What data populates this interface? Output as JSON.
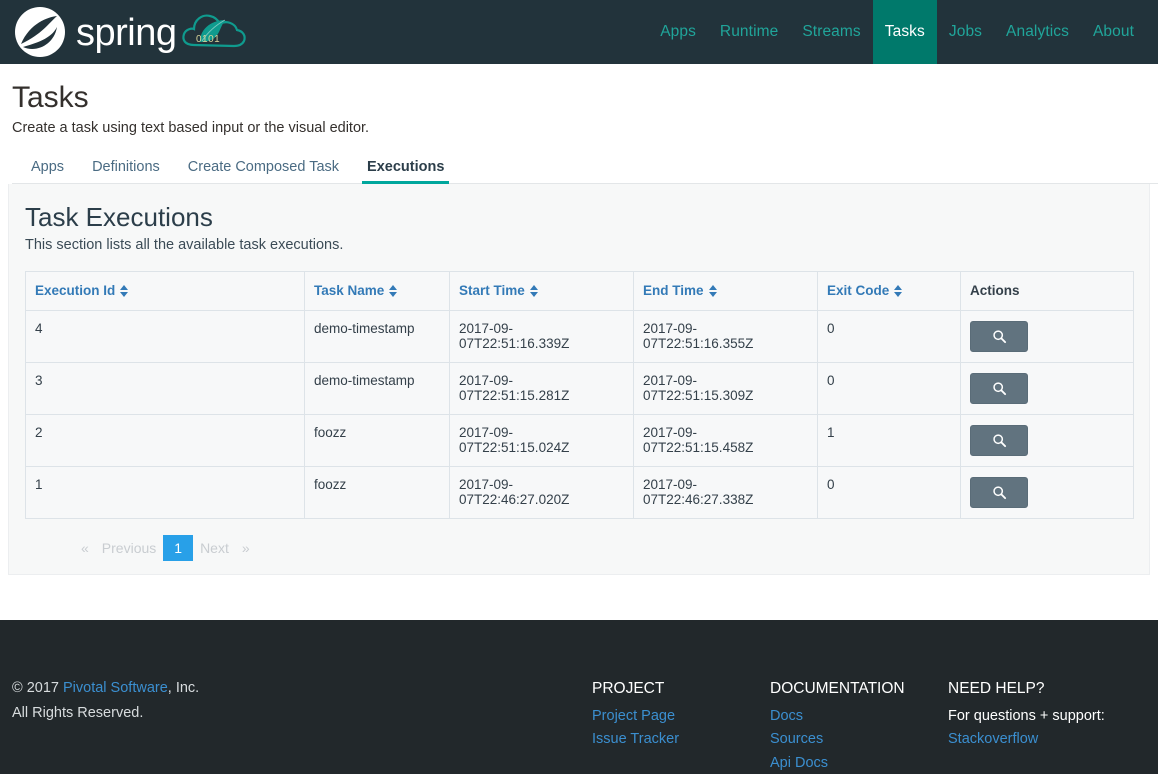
{
  "navbar": {
    "brand_name": "spring",
    "brand_icon": "spring-leaf-logo",
    "cloud_icon": "spring-cloud-dataflow-icon",
    "items": [
      {
        "label": "Apps",
        "active": false
      },
      {
        "label": "Runtime",
        "active": false
      },
      {
        "label": "Streams",
        "active": false
      },
      {
        "label": "Tasks",
        "active": true
      },
      {
        "label": "Jobs",
        "active": false
      },
      {
        "label": "Analytics",
        "active": false
      },
      {
        "label": "About",
        "active": false
      }
    ],
    "bg_color": "#22333b",
    "link_color": "#20a59a",
    "active_bg_color": "#00796b"
  },
  "page": {
    "title": "Tasks",
    "subtitle": "Create a task using text based input or the visual editor."
  },
  "tabs": [
    {
      "label": "Apps",
      "active": false
    },
    {
      "label": "Definitions",
      "active": false
    },
    {
      "label": "Create Composed Task",
      "active": false
    },
    {
      "label": "Executions",
      "active": true
    }
  ],
  "section": {
    "title": "Task Executions",
    "subtitle": "This section lists all the available task executions."
  },
  "table": {
    "columns": [
      {
        "label": "Execution Id",
        "sortable": true
      },
      {
        "label": "Task Name",
        "sortable": true
      },
      {
        "label": "Start Time",
        "sortable": true
      },
      {
        "label": "End Time",
        "sortable": true
      },
      {
        "label": "Exit Code",
        "sortable": true
      },
      {
        "label": "Actions",
        "sortable": false
      }
    ],
    "rows": [
      {
        "execution_id": "4",
        "task_name": "demo-timestamp",
        "start_time": "2017-09-07T22:51:16.339Z",
        "end_time": "2017-09-07T22:51:16.355Z",
        "exit_code": "0",
        "action_icon": "magnifier-icon"
      },
      {
        "execution_id": "3",
        "task_name": "demo-timestamp",
        "start_time": "2017-09-07T22:51:15.281Z",
        "end_time": "2017-09-07T22:51:15.309Z",
        "exit_code": "0",
        "action_icon": "magnifier-icon"
      },
      {
        "execution_id": "2",
        "task_name": "foozz",
        "start_time": "2017-09-07T22:51:15.024Z",
        "end_time": "2017-09-07T22:51:15.458Z",
        "exit_code": "1",
        "action_icon": "magnifier-icon"
      },
      {
        "execution_id": "1",
        "task_name": "foozz",
        "start_time": "2017-09-07T22:46:27.020Z",
        "end_time": "2017-09-07T22:46:27.338Z",
        "exit_code": "0",
        "action_icon": "magnifier-icon"
      }
    ],
    "header_link_color": "#337ab7",
    "border_color": "#dde3e8",
    "action_button_color": "#61737f"
  },
  "pagination": {
    "first_symbol": "«",
    "previous_label": "Previous",
    "current_page": "1",
    "next_label": "Next",
    "last_symbol": "»",
    "active_color": "#28a0e8"
  },
  "footer": {
    "copyright_prefix": "© 2017 ",
    "company_link": "Pivotal Software",
    "copyright_suffix": ", Inc.",
    "rights": "All Rights Reserved.",
    "columns": [
      {
        "heading": "PROJECT",
        "links": [
          "Project Page",
          "Issue Tracker"
        ]
      },
      {
        "heading": "DOCUMENTATION",
        "links": [
          "Docs",
          "Sources",
          "Api Docs"
        ]
      }
    ],
    "help": {
      "heading": "NEED HELP?",
      "text": "For questions + support:",
      "link": "Stackoverflow"
    },
    "bg_color": "#22282b",
    "link_color": "#3b8fd0"
  }
}
